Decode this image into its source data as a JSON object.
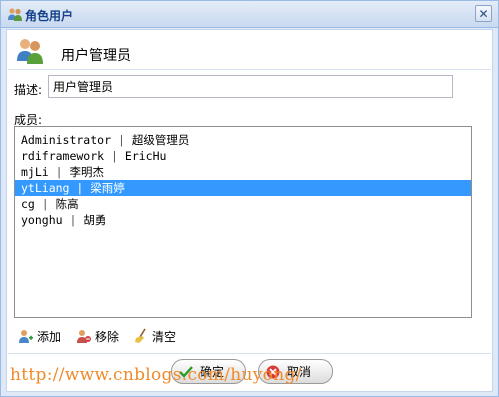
{
  "window": {
    "title": "角色用户",
    "close_glyph": "✕"
  },
  "header": {
    "title": "用户管理员",
    "icon": "users-icon"
  },
  "description": {
    "label": "描述:",
    "value": "用户管理员"
  },
  "members": {
    "label": "成员:",
    "items": [
      {
        "account": "Administrator",
        "separator": "|",
        "name": "超级管理员",
        "selected": false
      },
      {
        "account": "rdiframework",
        "separator": "|",
        "name": "EricHu",
        "selected": false
      },
      {
        "account": "mjLi",
        "separator": "|",
        "name": "李明杰",
        "selected": false
      },
      {
        "account": "ytLiang",
        "separator": "|",
        "name": "梁雨婷",
        "selected": true
      },
      {
        "account": "cg",
        "separator": "|",
        "name": "陈高",
        "selected": false
      },
      {
        "account": "yonghu",
        "separator": "|",
        "name": "胡勇",
        "selected": false
      }
    ]
  },
  "actions": {
    "add": "添加",
    "remove": "移除",
    "clear": "清空"
  },
  "buttons": {
    "ok": "确定",
    "cancel": "取消"
  },
  "watermark": "http://www.cnblogs.com/huyong/",
  "colors": {
    "selection": "#3399ff",
    "title_text": "#15428b",
    "watermark": "#f08a2a"
  }
}
